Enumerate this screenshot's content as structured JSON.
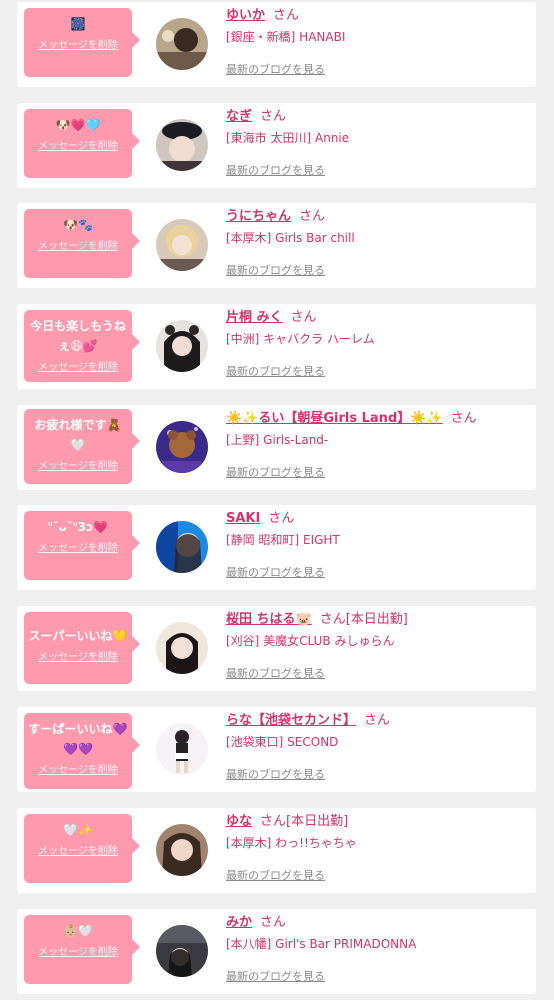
{
  "delete_label": "メッセージを削除",
  "san_label": "さん",
  "blog_label": "最新のブログを見る",
  "accent_color": "#d6336c",
  "bubble_color": "#ff9aae",
  "items": [
    {
      "message": "🎆",
      "name": "ゆいか",
      "status": "",
      "shop": "[銀座・新橋] HANABI"
    },
    {
      "message": "🐶💗🩵",
      "name": "なぎ",
      "status": "",
      "shop": "[東海市 太田川] Annie"
    },
    {
      "message": "🐶🐾",
      "name": "うにちゃん",
      "status": "",
      "shop": "[本厚木] Girls Bar chill"
    },
    {
      "message": "今日も楽しもうねぇ😆💕",
      "name": "片桐 みく",
      "status": "",
      "shop": "[中洲] キャバクラ ハーレム"
    },
    {
      "message": "お疲れ様です🧸🤍",
      "name": "☀️✨るい【朝昼Girls Land】☀️✨",
      "status": "",
      "shop": "[上野] Girls-Land-"
    },
    {
      "message": "ᐡ˘ᴗ˘ᐡ3ɔ💗",
      "name": "SAKI",
      "status": "",
      "shop": "[静岡 昭和町] EIGHT"
    },
    {
      "message": "スーパーいいね💛",
      "name": "桜田 ちはる🐷",
      "status": "[本日出勤]",
      "shop": "[刈谷] 美魔女CLUB みしゅらん"
    },
    {
      "message": "すーぱーいいね💜💜💜",
      "name": "らな【池袋セカンド】",
      "status": "",
      "shop": "[池袋東口] SECOND"
    },
    {
      "message": "🤍✨",
      "name": "ゆな",
      "status": "[本日出勤]",
      "shop": "[本厚木] わっ!!ちゃちゃ"
    },
    {
      "message": "👶🏼🤍",
      "name": "みか",
      "status": "",
      "shop": "[本八幡] Girl's Bar PRIMADONNA"
    }
  ]
}
